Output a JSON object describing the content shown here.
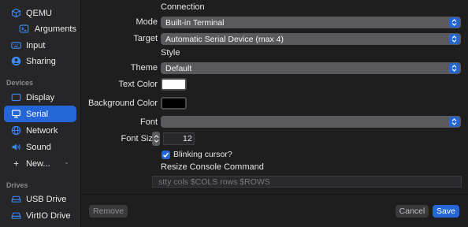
{
  "sidebar": {
    "items": [
      {
        "label": "QEMU",
        "icon": "cube-icon"
      },
      {
        "label": "Arguments",
        "icon": "terminal-icon"
      },
      {
        "label": "Input",
        "icon": "keyboard-icon"
      },
      {
        "label": "Sharing",
        "icon": "person-circle-icon"
      }
    ],
    "devices_header": "Devices",
    "devices": [
      {
        "label": "Display",
        "icon": "display-icon"
      },
      {
        "label": "Serial",
        "icon": "desktop-icon"
      },
      {
        "label": "Network",
        "icon": "network-icon"
      },
      {
        "label": "Sound",
        "icon": "speaker-icon"
      },
      {
        "label": "New...",
        "icon": "plus-icon"
      }
    ],
    "drives_header": "Drives",
    "drives": [
      {
        "label": "USB Drive",
        "icon": "drive-icon"
      },
      {
        "label": "VirtIO Drive",
        "icon": "drive-icon"
      }
    ]
  },
  "form": {
    "connection_header": "Connection",
    "mode_label": "Mode",
    "mode_value": "Built-in Terminal",
    "target_label": "Target",
    "target_value": "Automatic Serial Device (max 4)",
    "style_header": "Style",
    "theme_label": "Theme",
    "theme_value": "Default",
    "text_color_label": "Text Color",
    "text_color": "#ffffff",
    "bg_color_label": "Background Color",
    "bg_color": "#000000",
    "font_label": "Font",
    "font_value": "",
    "font_size_label": "Font Size",
    "font_size_value": "12",
    "blinking_label": "Blinking cursor?",
    "blinking_checked": true,
    "resize_header": "Resize Console Command",
    "resize_placeholder": "stty cols $COLS rows $ROWS"
  },
  "footer": {
    "remove_label": "Remove",
    "cancel_label": "Cancel",
    "save_label": "Save"
  },
  "colors": {
    "accent": "#2466d6",
    "sidebar_bg": "#262629",
    "main_bg": "#1e1e1e"
  }
}
